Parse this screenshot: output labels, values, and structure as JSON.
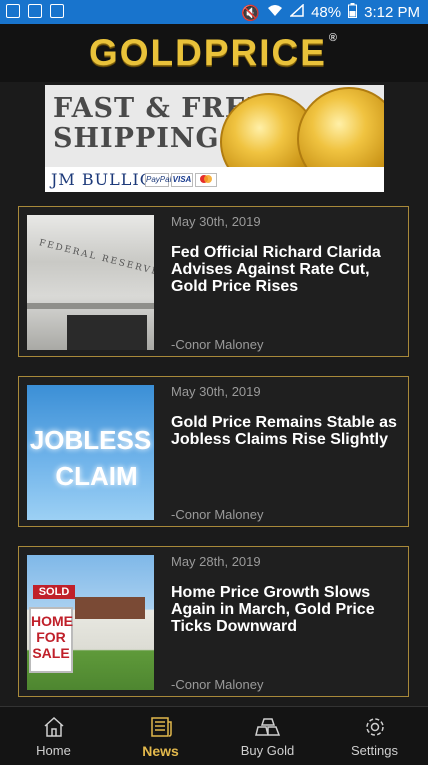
{
  "status": {
    "battery": "48%",
    "time": "3:12 PM"
  },
  "brand": {
    "logo_text": "GOLDPRICE",
    "registered": "®"
  },
  "banner": {
    "line1": "FAST & FREE",
    "line2": "SHIPPING",
    "sponsor": "JM BULLION",
    "payments": [
      "PayPal",
      "VISA",
      "MC"
    ]
  },
  "articles": [
    {
      "date": "May 30th, 2019",
      "title": "Fed Official Richard Clarida Advises Against Rate Cut, Gold Price Rises",
      "author": "-Conor Maloney",
      "thumb_text": "FEDERAL RESERVE"
    },
    {
      "date": "May 30th, 2019",
      "title": "Gold Price Remains Stable as Jobless Claims Rise Slightly",
      "author": "-Conor Maloney",
      "thumb_line1": "JOBLESS",
      "thumb_line2": "CLAIM"
    },
    {
      "date": "May 28th, 2019",
      "title": "Home Price Growth Slows Again in March, Gold Price Ticks Downward",
      "author": "-Conor Maloney",
      "sign_sold": "SOLD",
      "sign_line1": "HOME",
      "sign_line2": "FOR",
      "sign_line3": "SALE"
    }
  ],
  "tabs": [
    {
      "label": "Home",
      "icon": "home-icon",
      "active": false
    },
    {
      "label": "News",
      "icon": "news-icon",
      "active": true
    },
    {
      "label": "Buy Gold",
      "icon": "gold-bars-icon",
      "active": false
    },
    {
      "label": "Settings",
      "icon": "settings-icon",
      "active": false
    }
  ],
  "colors": {
    "status_bar": "#1874cd",
    "accent_gold": "#e2b84c",
    "card_border": "#a8893a"
  }
}
